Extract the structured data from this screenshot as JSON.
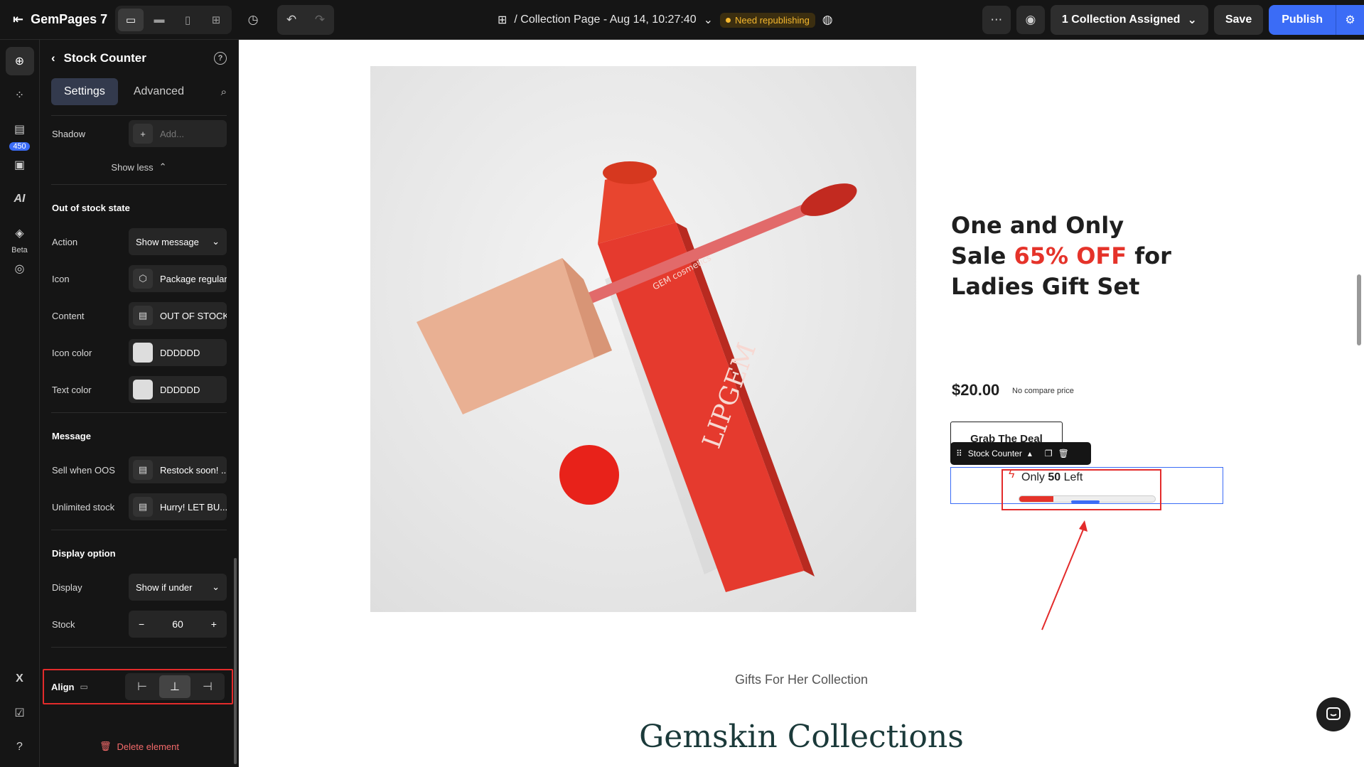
{
  "topbar": {
    "app_name": "GemPages 7",
    "page_title": "/ Collection Page - Aug 14, 10:27:40",
    "status_badge": "Need republishing",
    "collection_assigned": "1 Collection Assigned",
    "save_label": "Save",
    "publish_label": "Publish"
  },
  "rail": {
    "badge_count": "450",
    "ai_label": "AI",
    "beta_label": "Beta"
  },
  "panel": {
    "title": "Stock Counter",
    "tabs": [
      "Settings",
      "Advanced"
    ],
    "shadow_label": "Shadow",
    "shadow_placeholder": "Add...",
    "show_less": "Show less",
    "out_of_stock": {
      "title": "Out of stock state",
      "action_label": "Action",
      "action_value": "Show message",
      "icon_label": "Icon",
      "icon_value": "Package regular",
      "content_label": "Content",
      "content_value": "OUT OF STOCK",
      "icon_color_label": "Icon color",
      "icon_color_value": "DDDDDD",
      "text_color_label": "Text color",
      "text_color_value": "DDDDDD"
    },
    "message": {
      "title": "Message",
      "sell_oos_label": "Sell when OOS",
      "sell_oos_value": "Restock soon! ...",
      "unlimited_label": "Unlimited stock",
      "unlimited_value": "Hurry! LET BU..."
    },
    "display": {
      "title": "Display option",
      "display_label": "Display",
      "display_value": "Show if under",
      "stock_label": "Stock",
      "stock_value": "60",
      "align_label": "Align"
    },
    "delete_label": "Delete element"
  },
  "canvas": {
    "headline_line1": "One and Only",
    "headline_line2_a": "Sale ",
    "headline_line2_red": "65% OFF",
    "headline_line2_b": " for",
    "headline_line3": "Ladies Gift Set",
    "price": "$20.00",
    "compare_price": "No compare price",
    "deal_button": "Grab The Deal",
    "stock_toolbar_label": "Stock Counter",
    "stock_text_prefix": "Only ",
    "stock_count": "50",
    "stock_text_suffix": " Left",
    "stock_fill_fraction": 0.25,
    "product_brand": "LIPGEM",
    "product_cap_text": "GEM cosmetics",
    "collection_subtitle": "Gifts For Her Collection",
    "collection_title": "Gemskin Collections"
  },
  "colors": {
    "accent": "#3b6cf6",
    "sale_red": "#e5332a",
    "warning": "#f5b82e",
    "highlight": "#e32b2b",
    "swatch": "#dddddd"
  }
}
